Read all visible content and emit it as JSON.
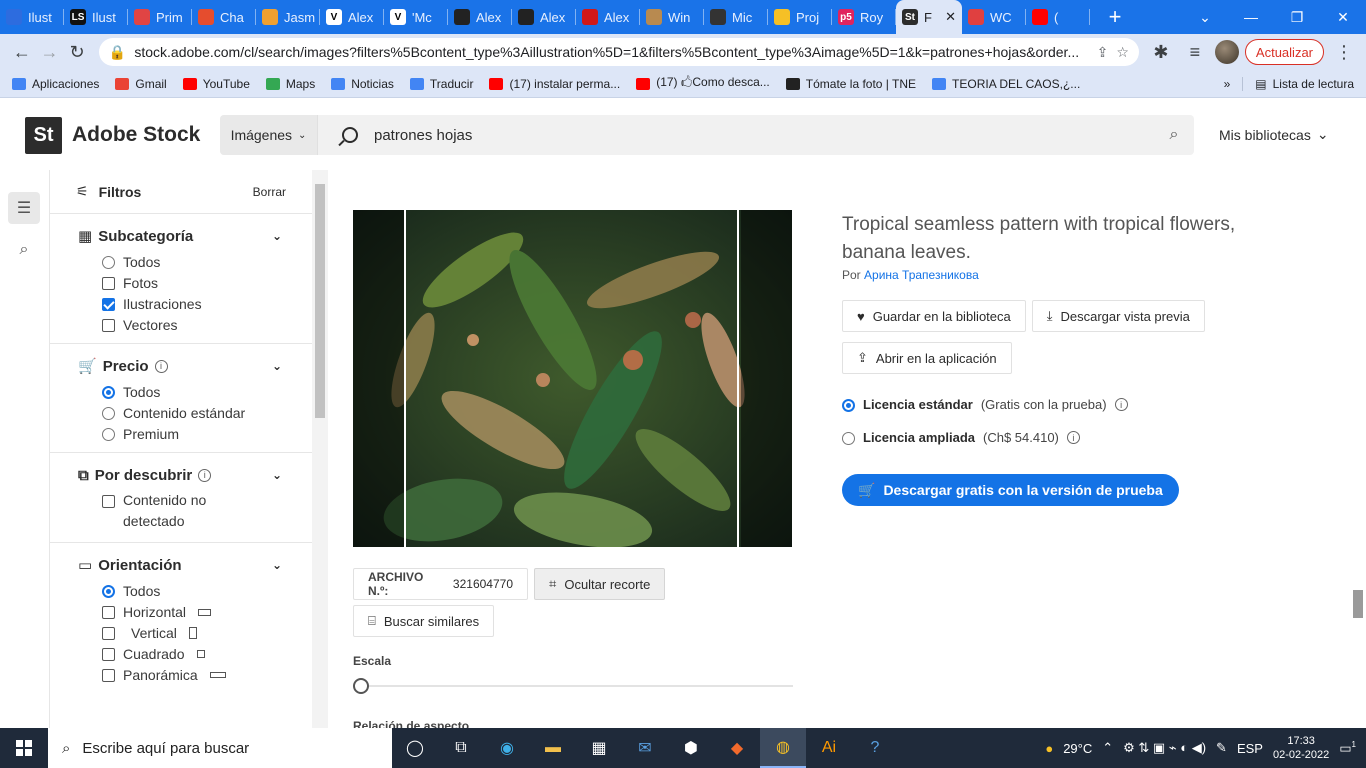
{
  "browser": {
    "tabs": [
      {
        "label": "Ilust",
        "fav_text": "",
        "fav_color": "#2d6cdf"
      },
      {
        "label": "Ilust",
        "fav_text": "LS",
        "fav_color": "#111111"
      },
      {
        "label": "Prim",
        "fav_text": "",
        "fav_color": "#e04444"
      },
      {
        "label": "Cha",
        "fav_text": "",
        "fav_color": "#e54d2e"
      },
      {
        "label": "Jasm",
        "fav_text": "",
        "fav_color": "#f0a030"
      },
      {
        "label": "Alex",
        "fav_text": "V",
        "fav_color": "#ffffff"
      },
      {
        "label": "'Mc",
        "fav_text": "V",
        "fav_color": "#ffffff"
      },
      {
        "label": "Alex",
        "fav_text": "",
        "fav_color": "#222222"
      },
      {
        "label": "Alex",
        "fav_text": "",
        "fav_color": "#222222"
      },
      {
        "label": "Alex",
        "fav_text": "",
        "fav_color": "#d01818"
      },
      {
        "label": "Win",
        "fav_text": "",
        "fav_color": "#b88a50"
      },
      {
        "label": "Mic",
        "fav_text": "",
        "fav_color": "#333333"
      },
      {
        "label": "Proj",
        "fav_text": "",
        "fav_color": "#f6c026"
      },
      {
        "label": "Roy",
        "fav_text": "p5",
        "fav_color": "#e0245e"
      },
      {
        "label": "F",
        "fav_text": "St",
        "fav_color": "#2c2c2c",
        "active": true
      },
      {
        "label": "WC",
        "fav_text": "",
        "fav_color": "#e04040"
      },
      {
        "label": "(",
        "fav_text": "",
        "fav_color": "#ff0000"
      }
    ],
    "url": "stock.adobe.com/cl/search/images?filters%5Bcontent_type%3Aillustration%5D=1&filters%5Bcontent_type%3Aimage%5D=1&k=patrones+hojas&order...",
    "update_label": "Actualizar",
    "bookmarks": [
      {
        "label": "Aplicaciones",
        "color": "#4285f4"
      },
      {
        "label": "Gmail",
        "color": "#ea4335"
      },
      {
        "label": "YouTube",
        "color": "#ff0000"
      },
      {
        "label": "Maps",
        "color": "#34a853"
      },
      {
        "label": "Noticias",
        "color": "#4285f4"
      },
      {
        "label": "Traducir",
        "color": "#4285f4"
      },
      {
        "label": "(17) instalar perma...",
        "color": "#ff0000"
      },
      {
        "label": "(17) 🖒Como desca...",
        "color": "#ff0000"
      },
      {
        "label": "Tómate la foto | TNE",
        "color": "#222222"
      },
      {
        "label": "TEORIA DEL CAOS,¿...",
        "color": "#4285f4"
      }
    ],
    "reading_list": "Lista de lectura"
  },
  "header": {
    "logo_mark": "St",
    "logo_name": "Adobe Stock",
    "search_type": "Imágenes",
    "search_query": "patrones hojas",
    "my_libraries": "Mis bibliotecas"
  },
  "filters": {
    "title": "Filtros",
    "clear": "Borrar",
    "sections": {
      "subcategory": {
        "title": "Subcategoría",
        "options": [
          "Todos",
          "Fotos",
          "Ilustraciones",
          "Vectores"
        ]
      },
      "price": {
        "title": "Precio",
        "options": [
          "Todos",
          "Contenido estándar",
          "Premium"
        ]
      },
      "discover": {
        "title": "Por descubrir",
        "options": [
          "Contenido no detectado"
        ]
      },
      "orientation": {
        "title": "Orientación",
        "options": [
          "Todos",
          "Horizontal",
          "Vertical",
          "Cuadrado",
          "Panorámica"
        ]
      }
    }
  },
  "asset": {
    "title": "Tropical seamless pattern with tropical flowers, banana leaves.",
    "by_label": "Por",
    "author": "Арина Трапезникова",
    "save_label": "Guardar en la biblioteca",
    "preview_label": "Descargar vista previa",
    "open_app_label": "Abrir en la aplicación",
    "license_std": "Licencia estándar",
    "license_std_note": "(Gratis con la prueba)",
    "license_ext": "Licencia ampliada",
    "license_ext_note": "(Ch$ 54.410)",
    "download_label": "Descargar gratis con la versión de prueba",
    "file_label": "ARCHIVO N.º:",
    "file_number": "321604770",
    "hide_crop_label": "Ocultar recorte",
    "find_similar_label": "Buscar similares",
    "scale_label": "Escala",
    "aspect_label": "Relación de aspecto"
  },
  "taskbar": {
    "search_placeholder": "Escribe aquí para buscar",
    "weather": "29°C",
    "language": "ESP",
    "time": "17:33",
    "date": "02-02-2022",
    "notif_count": "1"
  }
}
